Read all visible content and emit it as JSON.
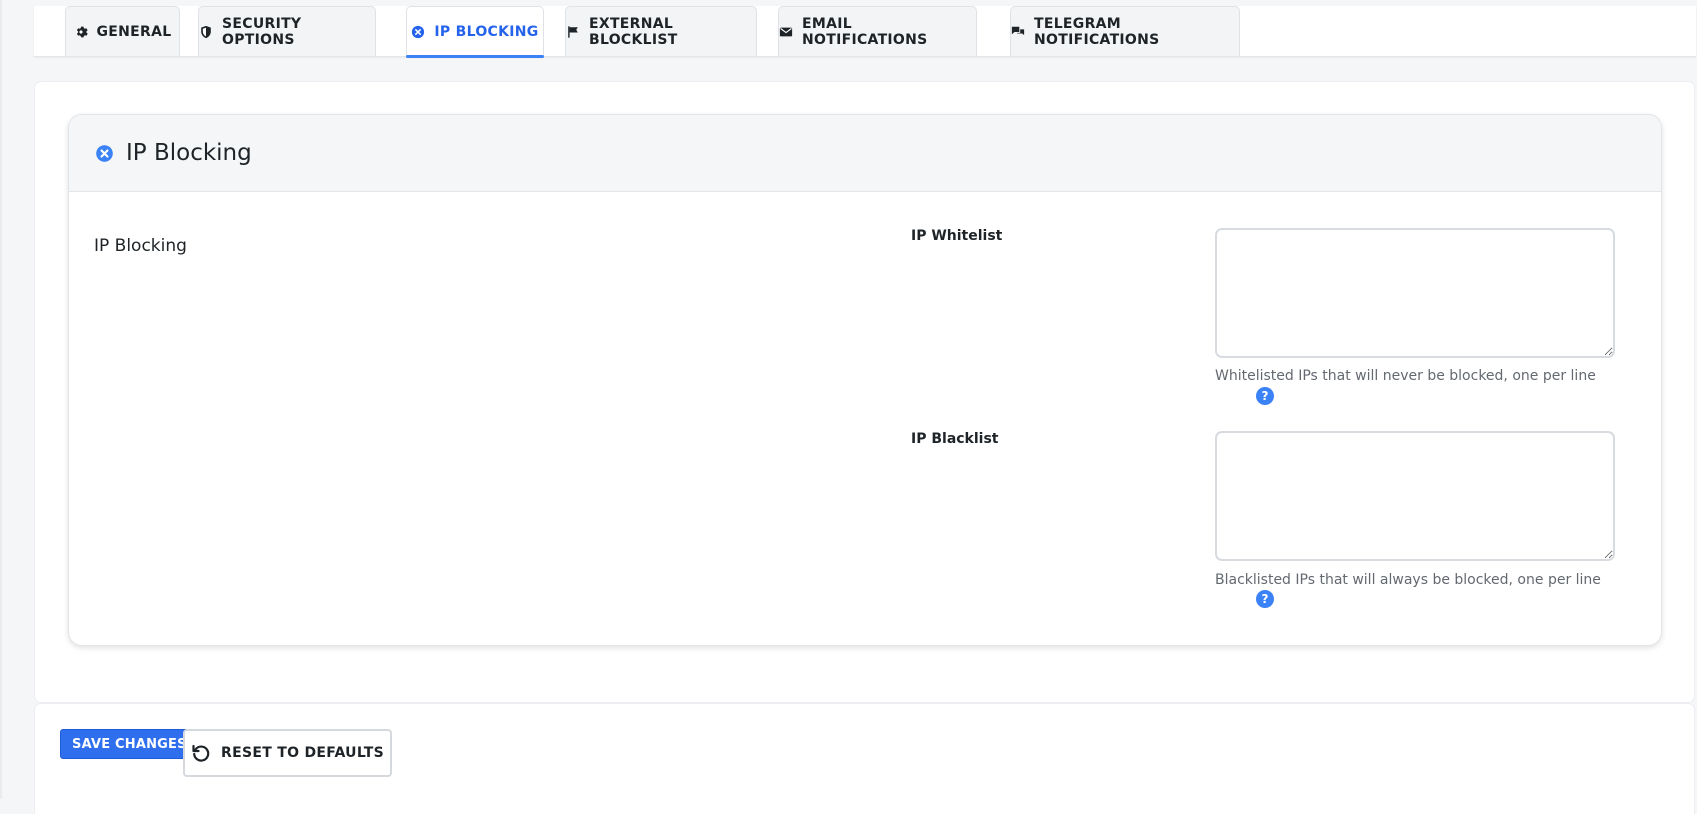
{
  "tabs": [
    {
      "label": "GENERAL",
      "icon": "gear-icon",
      "active": false
    },
    {
      "label": "SECURITY OPTIONS",
      "icon": "shield-icon",
      "active": false
    },
    {
      "label": "IP BLOCKING",
      "icon": "circle-x-icon",
      "active": true
    },
    {
      "label": "EXTERNAL BLOCKLIST",
      "icon": "flag-icon",
      "active": false
    },
    {
      "label": "EMAIL NOTIFICATIONS",
      "icon": "envelope-icon",
      "active": false
    },
    {
      "label": "TELEGRAM NOTIFICATIONS",
      "icon": "comments-icon",
      "active": false
    }
  ],
  "card": {
    "title": "IP Blocking",
    "icon": "circle-x-icon",
    "section_title": "IP Blocking"
  },
  "fields": {
    "whitelist": {
      "label": "IP Whitelist",
      "value": "",
      "help": "Whitelisted IPs that will never be blocked, one per line"
    },
    "blacklist": {
      "label": "IP Blacklist",
      "value": "",
      "help": "Blacklisted IPs that will always be blocked, one per line"
    }
  },
  "footer": {
    "save_label": "SAVE CHANGES",
    "reset_label": "RESET TO DEFAULTS",
    "reset_icon": "undo-icon"
  },
  "colors": {
    "accent": "#3b82f6",
    "active_tab_text": "#2563eb",
    "save_button": "#2f6fed"
  }
}
